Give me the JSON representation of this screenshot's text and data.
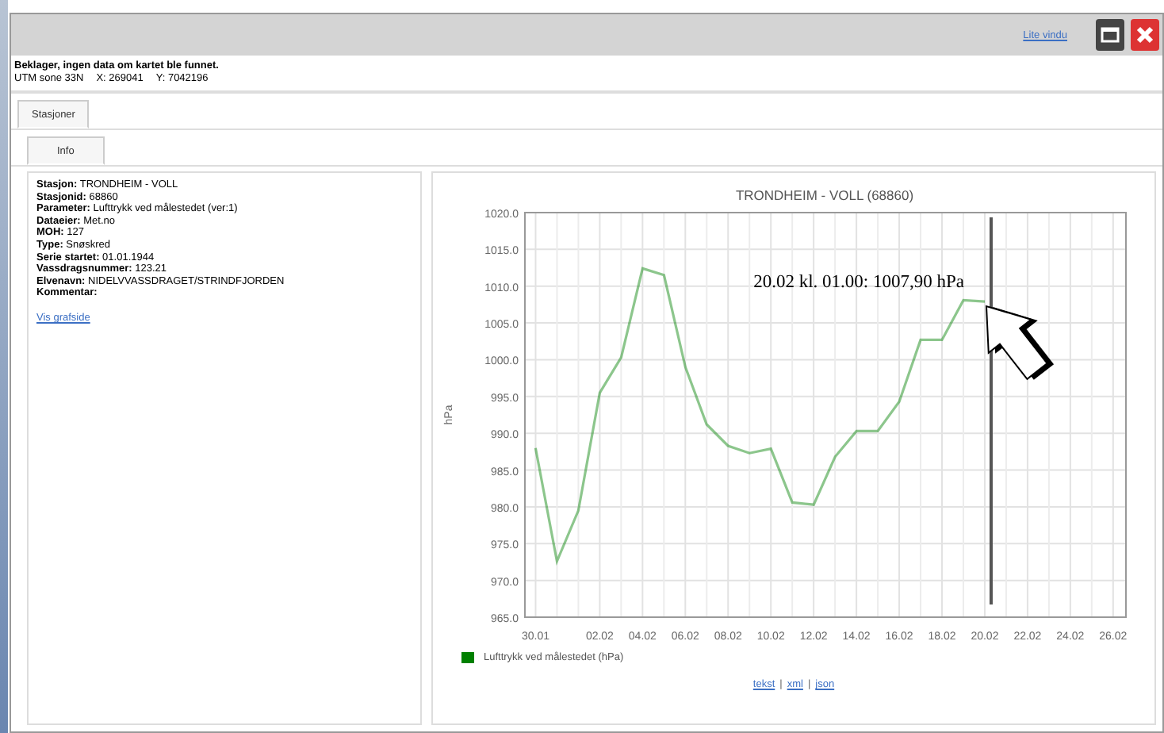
{
  "window": {
    "link": "Lite vindu"
  },
  "message": {
    "text": "Beklager, ingen data om kartet ble funnet.",
    "coords": [
      "UTM sone 33N",
      "X: 269041",
      "Y: 7042196"
    ]
  },
  "tabs": [
    {
      "label": "Stasjoner",
      "selected": true
    }
  ],
  "subtabs": [
    {
      "label": "Info",
      "selected": true
    }
  ],
  "info": [
    {
      "label": "Stasjon:",
      "value": "TRONDHEIM - VOLL"
    },
    {
      "label": "Stasjonid:",
      "value": "68860"
    },
    {
      "label": "Parameter:",
      "value": "Lufttrykk ved målestedet (ver:1)"
    },
    {
      "label": "Dataeier:",
      "value": "Met.no"
    },
    {
      "label": "MOH:",
      "value": "127"
    },
    {
      "label": "Type:",
      "value": "Snøskred"
    },
    {
      "label": "Serie startet:",
      "value": "01.01.1944"
    },
    {
      "label": "Vassdragsnummer:",
      "value": "123.21"
    },
    {
      "label": "Elvenavn:",
      "value": "NIDELVVASSDRAGET/STRINDFJORDEN"
    },
    {
      "label": "Kommentar:"
    }
  ],
  "info_link": "Vis grafside",
  "chart": {
    "chart_data": {
      "type": "line",
      "title": "TRONDHEIM - VOLL (68860)",
      "ylabel": "hPa",
      "grid": true,
      "categories": [
        "30.01",
        null,
        null,
        "02.02",
        null,
        "04.02",
        null,
        "06.02",
        null,
        "08.02",
        null,
        "10.02",
        null,
        "12.02",
        null,
        "14.02",
        null,
        "16.02",
        null,
        "18.02",
        null,
        "20.02",
        null,
        "22.02",
        null,
        "24.02",
        null,
        "26.02"
      ],
      "series": [
        {
          "name": "Lufttrykk ved målestedet (hPa)",
          "color": "#008000",
          "values": [
            988.0,
            972.6,
            979.5,
            995.5,
            1000.3,
            1012.4,
            1011.5,
            999.0,
            991.2,
            988.3,
            987.3,
            987.9,
            980.6,
            980.3,
            986.8,
            990.3,
            990.3,
            994.3,
            1002.7,
            1002.7,
            1008.1,
            1007.9,
            null,
            null,
            null,
            null,
            null,
            null
          ]
        }
      ],
      "ylim": [
        965,
        1020
      ],
      "yticks": [
        {
          "value": 965,
          "label": "965.0"
        },
        {
          "value": 970,
          "label": "970.0"
        },
        {
          "value": 975,
          "label": "975.0"
        },
        {
          "value": 980,
          "label": "980.0"
        },
        {
          "value": 985,
          "label": "985.0"
        },
        {
          "value": 990,
          "label": "990.0"
        },
        {
          "value": 995,
          "label": "995.0"
        },
        {
          "value": 1000,
          "label": "1000.0"
        },
        {
          "value": 1005,
          "label": "1005.0"
        },
        {
          "value": 1010,
          "label": "1010.0"
        },
        {
          "value": 1015,
          "label": "1015.0"
        },
        {
          "value": 1020,
          "label": "1020.0"
        }
      ],
      "ref_lines": [
        {
          "axis": "x",
          "value": "20.02"
        }
      ],
      "annotations": [
        "20.02 kl. 01.00: 1007,90 hPa"
      ]
    },
    "links": [
      "tekst",
      "xml",
      "json"
    ],
    "link_separator": "|"
  }
}
